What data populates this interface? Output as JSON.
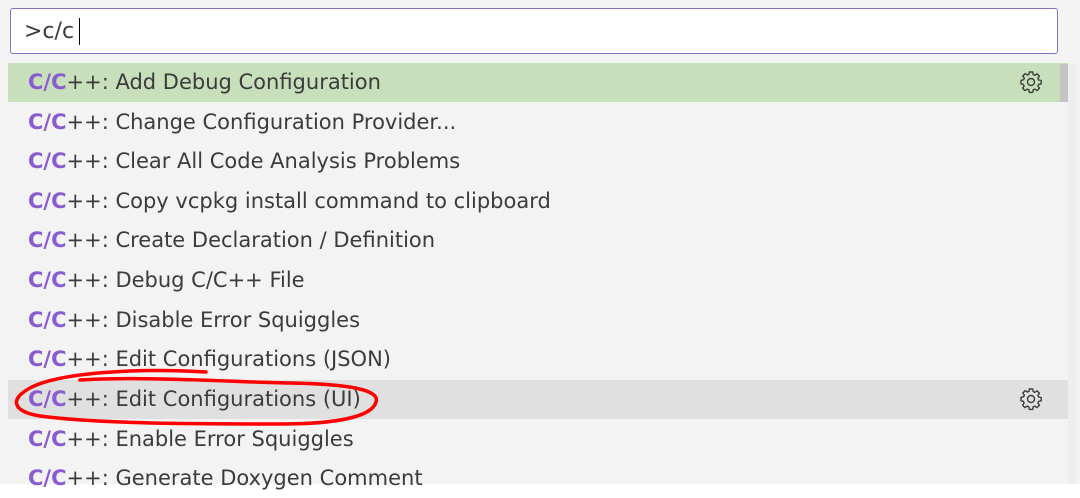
{
  "search": {
    "value": ">c/c"
  },
  "items": [
    {
      "match": "C/C",
      "rest": "++: Add Debug Configuration"
    },
    {
      "match": "C/C",
      "rest": "++: Change Configuration Provider..."
    },
    {
      "match": "C/C",
      "rest": "++: Clear All Code Analysis Problems"
    },
    {
      "match": "C/C",
      "rest": "++: Copy vcpkg install command to clipboard"
    },
    {
      "match": "C/C",
      "rest": "++: Create Declaration / Definition"
    },
    {
      "match": "C/C",
      "rest": "++: Debug C/C++ File"
    },
    {
      "match": "C/C",
      "rest": "++: Disable Error Squiggles"
    },
    {
      "match": "C/C",
      "rest": "++: Edit Configurations (JSON)"
    },
    {
      "match": "C/C",
      "rest": "++: Edit Configurations (UI)"
    },
    {
      "match": "C/C",
      "rest": "++: Enable Error Squiggles"
    },
    {
      "match": "C/C",
      "rest": "++: Generate Doxygen Comment"
    }
  ],
  "icons": {
    "gear": "gear-icon"
  },
  "colors": {
    "selected_bg": "#c8dfbb",
    "hover_bg": "#e0e0e0",
    "match": "#8a5cd1",
    "annotation": "#ff0000"
  }
}
